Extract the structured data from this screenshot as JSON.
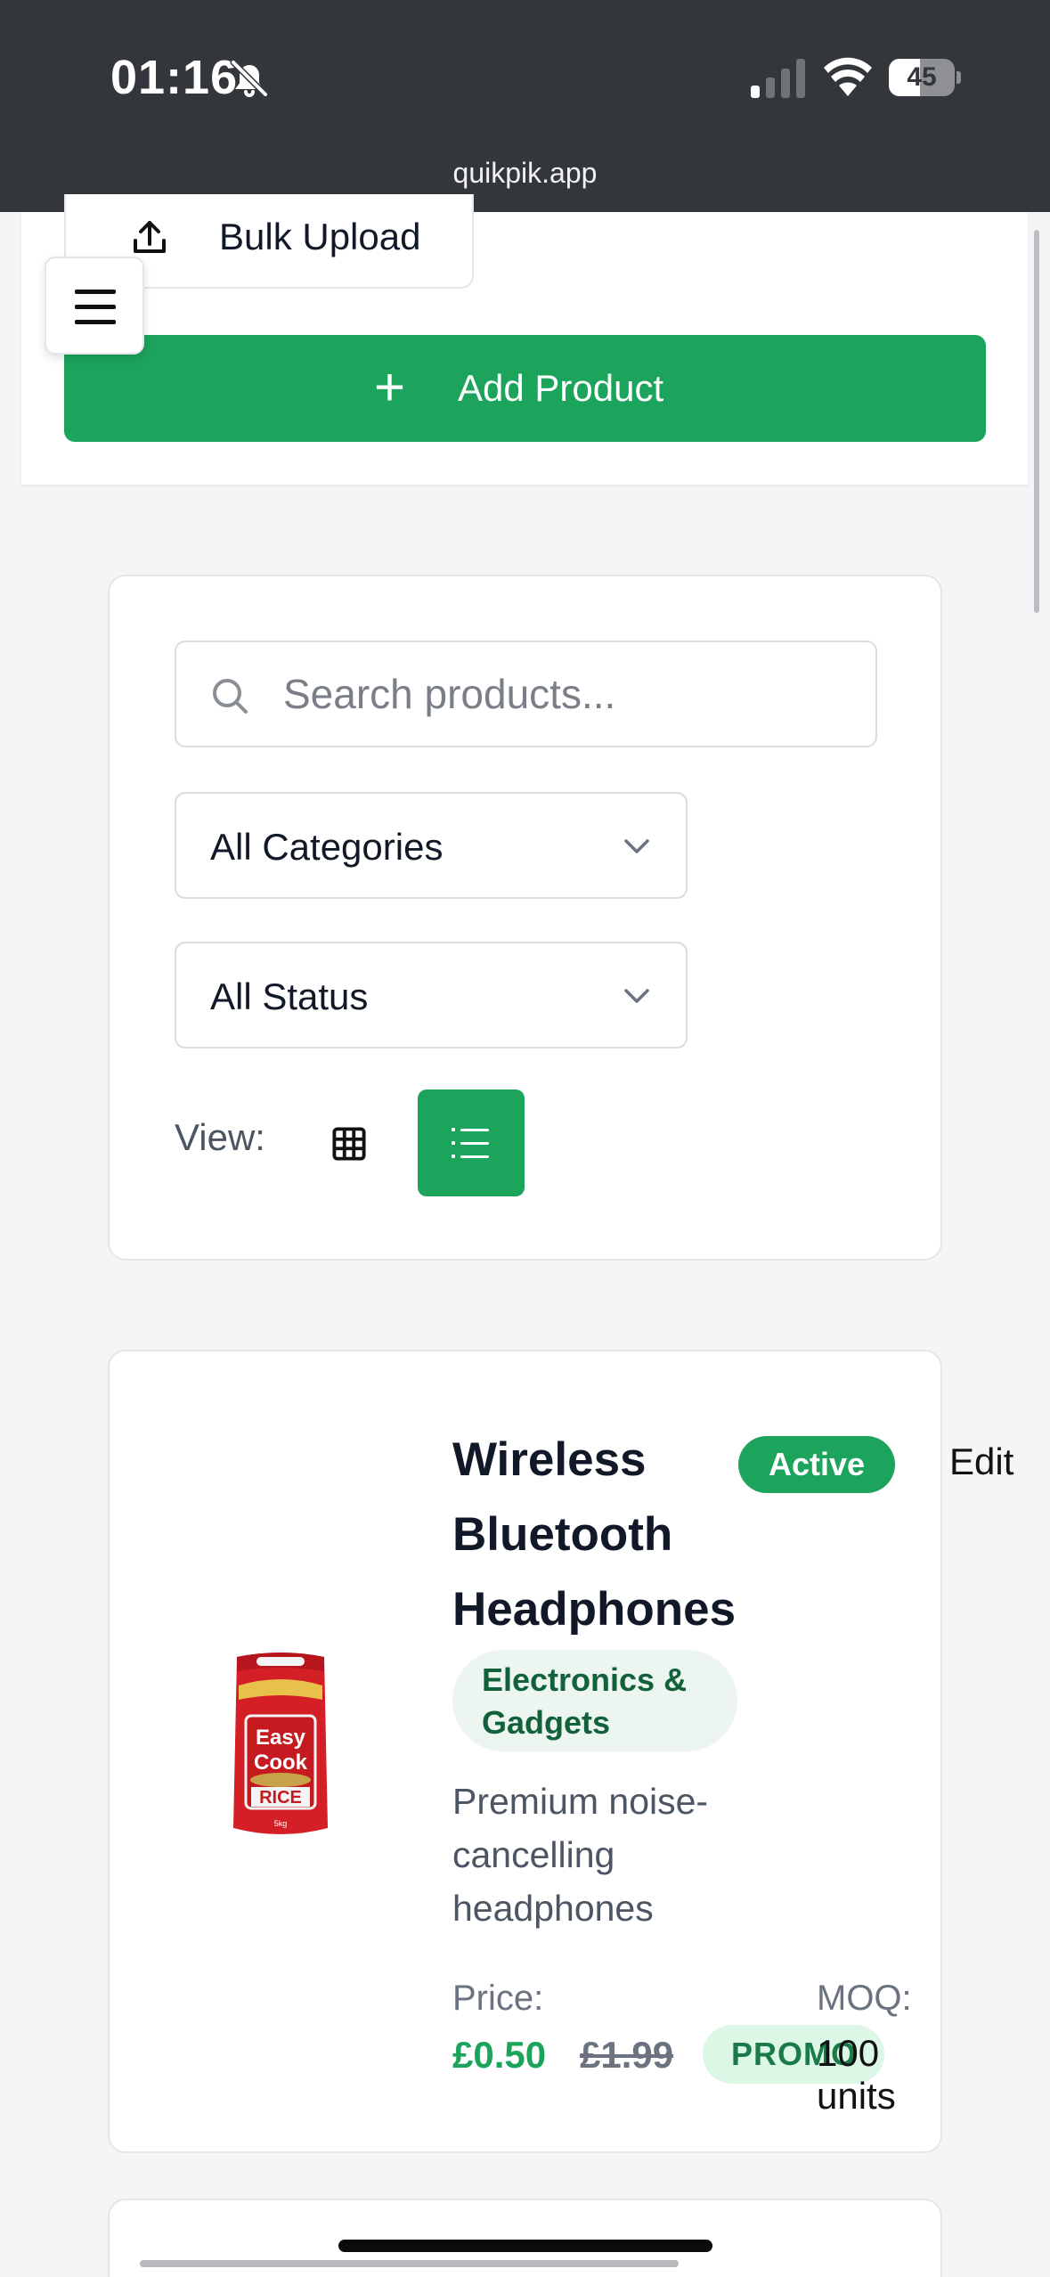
{
  "status_bar": {
    "time": "01:16",
    "battery": "45",
    "url": "quikpik.app",
    "icons": [
      "bell-slash-icon",
      "signal-icon",
      "wifi-icon",
      "battery-icon"
    ]
  },
  "toolbar": {
    "bulk_upload_label": "Bulk Upload",
    "add_product_label": "Add Product",
    "add_product_icon": "+"
  },
  "filters": {
    "search_placeholder": "Search products...",
    "category_value": "All Categories",
    "status_value": "All Status",
    "view_label": "View:",
    "active_view": "list"
  },
  "products": [
    {
      "name": "Wireless Bluetooth Headphones",
      "status": "Active",
      "edit_label": "Edit",
      "category": "Electronics & Gadgets",
      "description": "Premium noise-cancelling headphones",
      "price_label": "Price:",
      "price": "£0.50",
      "original_price": "£1.99",
      "promo_label": "PROMO",
      "moq_label": "MOQ:",
      "moq_value": "100 units",
      "image_text": "Easy Cook RICE"
    }
  ],
  "colors": {
    "brand_green": "#1ca35c",
    "status_bar": "#33363a",
    "page_bg": "#f4f5f7"
  }
}
